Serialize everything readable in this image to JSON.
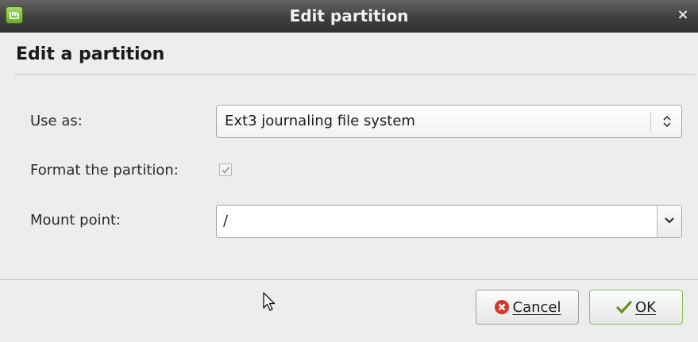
{
  "window": {
    "title": "Edit partition",
    "close_glyph": "×",
    "app_icon": "linux-mint-icon"
  },
  "heading": "Edit a partition",
  "form": {
    "use_as": {
      "label": "Use as:",
      "value": "Ext3 journaling file system"
    },
    "format": {
      "label": "Format the partition:",
      "checked": true,
      "enabled": false
    },
    "mount_point": {
      "label": "Mount point:",
      "value": "/"
    }
  },
  "buttons": {
    "cancel": {
      "label": "Cancel",
      "icon": "cancel-icon"
    },
    "ok": {
      "label": "OK",
      "icon": "checkmark-icon"
    }
  },
  "colors": {
    "titlebar": "#3f3f3f",
    "window_bg": "#ededed",
    "cancel_icon": "#d9362b",
    "ok_icon": "#5a9a1e",
    "ok_border": "#8dbb57"
  }
}
